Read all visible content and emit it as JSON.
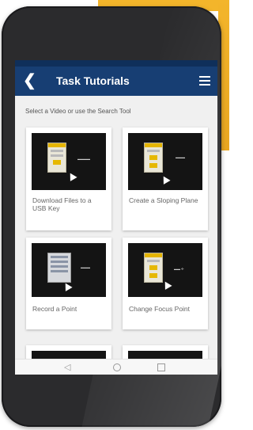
{
  "app": {
    "title": "Task Tutorials",
    "subtitle": "Select a Video or use the Search Tool"
  },
  "header": {
    "back_glyph": "❮",
    "menu_icon": "hamburger-menu-icon"
  },
  "cards": [
    {
      "label": "Download Files to a USB Key"
    },
    {
      "label": "Create a Sloping Plane"
    },
    {
      "label": "Record a Point"
    },
    {
      "label": "Change Focus Point"
    }
  ],
  "navbar": {
    "back_glyph": "◁"
  },
  "colors": {
    "header_blue": "#173e73",
    "accent_yellow": "#f3b52b",
    "phone_body": "#2b2b2d"
  }
}
